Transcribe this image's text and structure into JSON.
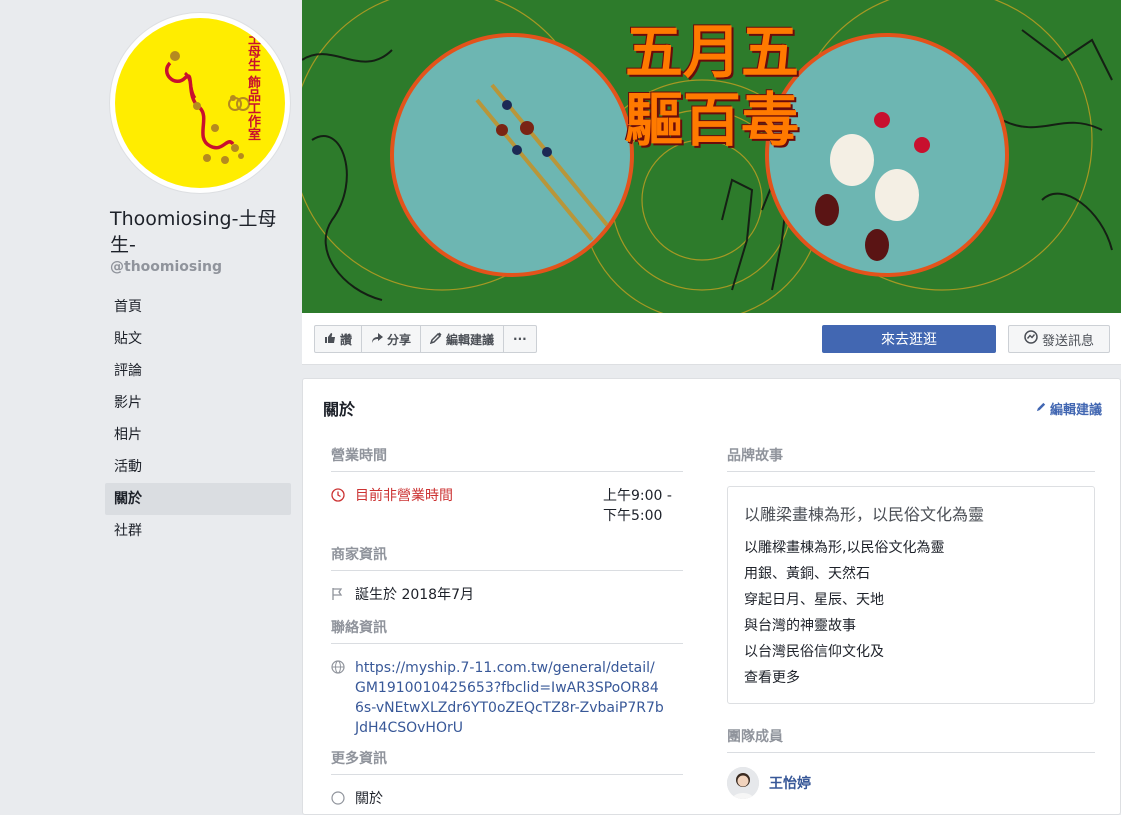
{
  "page": {
    "name": "Thoomiosing-土母生-",
    "handle": "@thoomiosing",
    "logo_text": "土母生 飾品工作室"
  },
  "nav": [
    {
      "label": "首頁"
    },
    {
      "label": "貼文"
    },
    {
      "label": "評論"
    },
    {
      "label": "影片"
    },
    {
      "label": "相片"
    },
    {
      "label": "活動"
    },
    {
      "label": "關於"
    },
    {
      "label": "社群"
    }
  ],
  "cover": {
    "headline_line1": "五月五",
    "headline_line2": "驅百毒",
    "bg_color": "#2d7b2b",
    "accent_color": "#ff7a00"
  },
  "actions": {
    "like": "讚",
    "share": "分享",
    "edit_suggest": "編輯建議",
    "more": "···",
    "cta": "來去逛逛",
    "message": "發送訊息"
  },
  "about": {
    "title": "關於",
    "edit": "編輯建議",
    "hours": {
      "heading": "營業時間",
      "status": "目前非營業時間",
      "range_line1": "上午9:00 -",
      "range_line2": "下午5:00"
    },
    "business": {
      "heading": "商家資訊",
      "founded": "誕生於 2018年7月"
    },
    "contact": {
      "heading": "聯絡資訊",
      "url": "https://myship.7-11.com.tw/general/detail/GM1910010425653?fbclid=IwAR3SPoOR846s-vNEtwXLZdr6YT0oZEQcTZ8r-ZvbaiP7R7bJdH4CSOvHOrU"
    },
    "more": {
      "heading": "更多資訊",
      "first_item": "關於"
    },
    "story": {
      "heading": "品牌故事",
      "title": "以雕梁畫棟為形，以民俗文化為靈",
      "lines": [
        "以雕樑畫棟為形,以民俗文化為靈",
        "用銀、黃銅、天然石",
        "穿起日月、星辰、天地",
        "與台灣的神靈故事",
        "以台灣民俗信仰文化及"
      ],
      "see_more": "查看更多"
    },
    "team": {
      "heading": "團隊成員",
      "member_name": "王怡婷"
    }
  },
  "colors": {
    "facebook_blue": "#4267b2",
    "link_blue": "#385898",
    "closed_red": "#cc3333"
  }
}
